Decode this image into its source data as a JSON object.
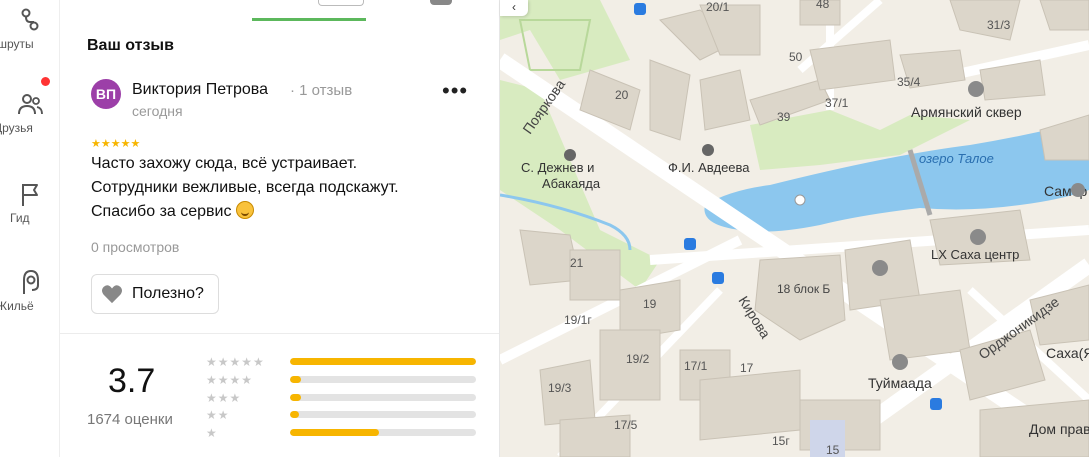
{
  "rail": {
    "items": [
      {
        "label": "аршруты",
        "icon": "routes-icon"
      },
      {
        "label": "Друзья",
        "icon": "friends-icon",
        "badge_color": "#ff3333"
      },
      {
        "label": "Гид",
        "icon": "flag-icon"
      },
      {
        "label": "Жильё",
        "icon": "housing-icon"
      }
    ]
  },
  "review": {
    "section_title": "Ваш отзыв",
    "avatar_initials": "ВП",
    "avatar_color": "#9c3fa8",
    "author": "Виктория Петрова",
    "reviews_count": "· 1 отзыв",
    "date": "сегодня",
    "more_label": "•••",
    "stars": 5,
    "stars_glyphs": "★★★★★",
    "text_line1": "Часто захожу сюда, всё устраивает.",
    "text_line2": "Сотрудники вежливые, всегда подскажут.",
    "text_line3": "Спасибо за сервис",
    "views": "0 просмотров",
    "useful_label": "Полезно?"
  },
  "rating": {
    "value": "3.7",
    "count": "1674 оценки",
    "distribution": [
      {
        "stars": 5,
        "glyphs": "★★★★★",
        "fraction": 1.0
      },
      {
        "stars": 4,
        "glyphs": "★★★★",
        "fraction": 0.06
      },
      {
        "stars": 3,
        "glyphs": "★★★",
        "fraction": 0.06
      },
      {
        "stars": 2,
        "glyphs": "★★",
        "fraction": 0.05
      },
      {
        "stars": 1,
        "glyphs": "★",
        "fraction": 0.48
      }
    ],
    "accent_color": "#f7b500"
  },
  "map": {
    "collapse_label": "‹",
    "streets": [
      "Пояркова",
      "Кирова",
      "Орджоникидзе"
    ],
    "places": [
      "Армянский сквер",
      "озеро Талое",
      "Ф.И. Авдеева",
      "С. Дежнев и",
      "Абакаяда",
      "LX Саха центр",
      "Туймаада",
      "Дом прави",
      "Саха(Я",
      "Самор",
      "18 блок Б"
    ],
    "house_numbers": [
      "20/1",
      "48",
      "31/3",
      "50",
      "35/4",
      "20",
      "37/1",
      "39",
      "21",
      "19",
      "19/1г",
      "19/2",
      "17/1",
      "17",
      "19/3",
      "17/5",
      "15г",
      "15"
    ]
  }
}
